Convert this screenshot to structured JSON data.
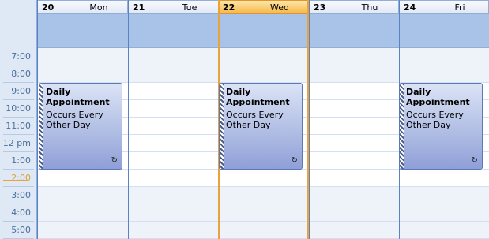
{
  "days": [
    {
      "num": "20",
      "name": "Mon",
      "today": false
    },
    {
      "num": "21",
      "name": "Tue",
      "today": false
    },
    {
      "num": "22",
      "name": "Wed",
      "today": true
    },
    {
      "num": "23",
      "name": "Thu",
      "today": false
    },
    {
      "num": "24",
      "name": "Fri",
      "today": false
    }
  ],
  "times": [
    "7:00",
    "8:00",
    "9:00",
    "10:00",
    "11:00",
    "12 pm",
    "1:00",
    "2:00",
    "3:00",
    "4:00",
    "5:00"
  ],
  "current_time_label": "2:00",
  "appointments": [
    {
      "day": "Mon",
      "title": "Daily Appointment",
      "description": "Occurs Every Other Day",
      "recurring_icon": "recurrence-icon"
    },
    {
      "day": "Wed",
      "title": "Daily Appointment",
      "description": "Occurs Every Other Day",
      "recurring_icon": "recurrence-icon"
    },
    {
      "day": "Fri",
      "title": "Daily Appointment",
      "description": "Occurs Every Other Day",
      "recurring_icon": "recurrence-icon"
    }
  ],
  "colors": {
    "today_accent": "#e8a33d",
    "appointment_fill": "#a6b5e0",
    "allday_band": "#a9c3e8"
  }
}
